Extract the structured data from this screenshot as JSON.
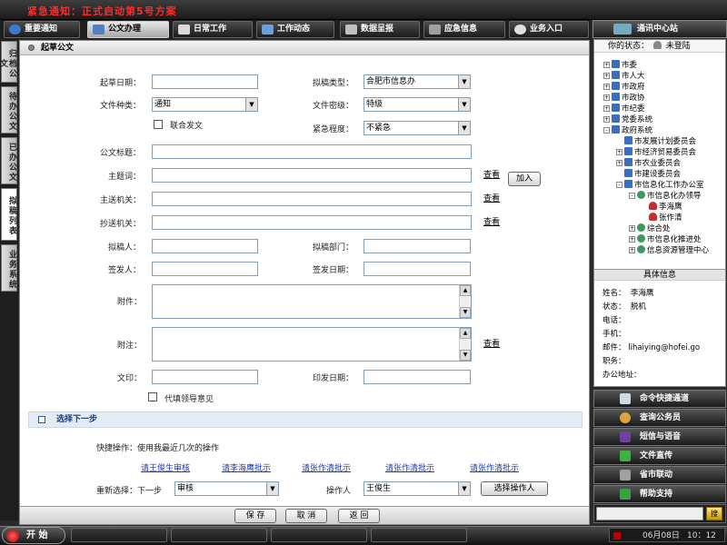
{
  "notice": "紧急通知：正式启动第5号方案",
  "tabs": [
    {
      "label": "重要通知",
      "color": "#3c7ad0"
    },
    {
      "label": "公文办理",
      "color": "#5080c0"
    },
    {
      "label": "日常工作",
      "color": "#d9d9d9"
    },
    {
      "label": "工作动态",
      "color": "#6aa0d8"
    },
    {
      "label": "数据呈报",
      "color": "#c0c0c0"
    },
    {
      "label": "应急信息",
      "color": "#a0a0a0"
    },
    {
      "label": "业务入口",
      "color": "#e0e0e0"
    }
  ],
  "side_tabs": [
    "归档公文",
    "待办公文",
    "已办公文",
    "拟稿列表",
    "业务系统"
  ],
  "form": {
    "title": "起草公文",
    "draft_date_label": "起草日期：",
    "draft_type_label": "拟稿类型：",
    "draft_type_value": "合肥市信息办",
    "doc_type_label": "文件种类：",
    "doc_type_value": "通知",
    "secrecy_label": "文件密级：",
    "secrecy_value": "特级",
    "joint_label": "联合发文",
    "urgency_label": "紧急程度：",
    "urgency_value": "不紧急",
    "subject_label": "公文标题：",
    "keywords_label": "主题词：",
    "main_recipient_label": "主送机关：",
    "cc_label": "抄送机关：",
    "drafter_label": "拟稿人：",
    "draft_dept_label": "拟稿部门：",
    "signer_label": "签发人：",
    "sign_date_label": "签发日期：",
    "attachment_label": "附件：",
    "remark_label": "附注：",
    "print_label": "文印：",
    "print_date_label": "印发日期：",
    "leader_label": "代填领导意见",
    "look": "查看",
    "add": "加入"
  },
  "next": {
    "title": "选择下一步",
    "quick_label": "快捷操作：使用我最近几次的操作",
    "quick_links": [
      "请王俊生审核",
      "请李海鹰批示",
      "请张作清批示",
      "请张作清批示",
      "请张作清批示"
    ],
    "reselect_label": "重新选择：下一步",
    "step_value": "审核",
    "operator_label": "操作人",
    "operator_value": "王俊生",
    "choose_operator": "选择操作人"
  },
  "actions": {
    "save": "保 存",
    "cancel": "取 消",
    "back": "返 回"
  },
  "right": {
    "title": "通讯中心站",
    "status_label": "你的状态：",
    "status_value": "未登陆",
    "tree": [
      {
        "label": "市委",
        "pm": "+"
      },
      {
        "label": "市人大",
        "pm": "+"
      },
      {
        "label": "市政府",
        "pm": "+"
      },
      {
        "label": "市政协",
        "pm": "+"
      },
      {
        "label": "市纪委",
        "pm": "+"
      },
      {
        "label": "党委系统",
        "pm": "+"
      },
      {
        "label": "政府系统",
        "pm": "-"
      },
      {
        "label": "市发展计划委员会",
        "pm": ""
      },
      {
        "label": "市经济贸易委员会",
        "pm": "+"
      },
      {
        "label": "市农业委员会",
        "pm": "+"
      },
      {
        "label": "市建设委员会",
        "pm": ""
      },
      {
        "label": "市信息化工作办公室",
        "pm": "-"
      },
      {
        "label": "市信息化办领导",
        "pm": "-"
      },
      {
        "label": "李海鹰",
        "pm": ""
      },
      {
        "label": "张作清",
        "pm": ""
      },
      {
        "label": "综合处",
        "pm": "+"
      },
      {
        "label": "市信息化推进处",
        "pm": "+"
      },
      {
        "label": "信息资源管理中心",
        "pm": "+"
      }
    ],
    "info_title": "具体信息",
    "info": [
      {
        "k": "姓名：",
        "v": "李海鹰"
      },
      {
        "k": "状态：",
        "v": "脱机"
      },
      {
        "k": "电话：",
        "v": ""
      },
      {
        "k": "手机：",
        "v": ""
      },
      {
        "k": "邮件：",
        "v": "lihaiying@hofei.go"
      },
      {
        "k": "职务：",
        "v": ""
      },
      {
        "k": "办公地址：",
        "v": ""
      }
    ],
    "buttons": [
      {
        "label": "命令快捷通道",
        "color": "#cfd8e8"
      },
      {
        "label": "查询公务员",
        "color": "#e0a040"
      },
      {
        "label": "短信与语音",
        "color": "#7040a0"
      },
      {
        "label": "文件直传",
        "color": "#40b040"
      },
      {
        "label": "省市联动",
        "color": "#a0a0a0"
      },
      {
        "label": "帮助支持",
        "color": "#40a040"
      }
    ],
    "search_go": "搜"
  },
  "taskbar": {
    "start": "开 始",
    "date": "06月08日",
    "time": "10：12"
  }
}
